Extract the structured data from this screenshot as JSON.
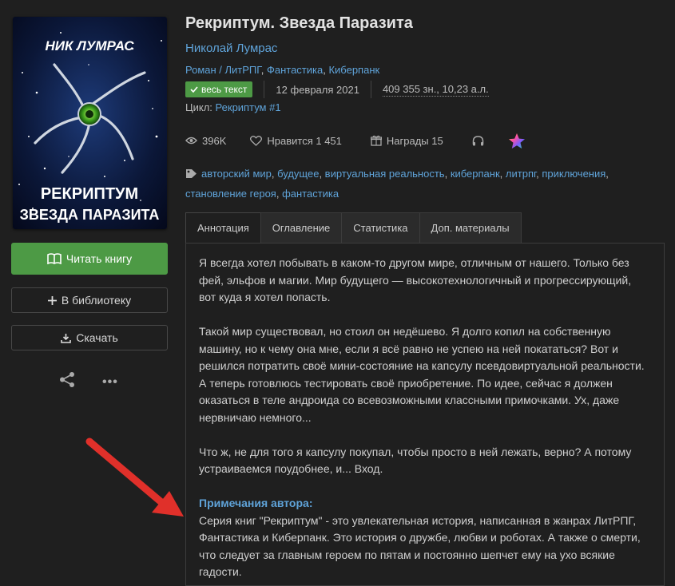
{
  "book": {
    "title": "Рекриптум. Звезда Паразита",
    "author": "Николай Лумрас",
    "genres": [
      "Роман / ЛитРПГ",
      "Фантастика",
      "Киберпанк"
    ],
    "status_badge": "весь текст",
    "date": "12 февраля 2021",
    "chars": "409 355 зн., 10,23 а.л.",
    "cycle_label": "Цикл:",
    "cycle": "Рекриптум #1"
  },
  "cover": {
    "author_text": "НИК ЛУМРАС",
    "title_line1": "РЕКРИПТУМ",
    "title_line2": "ЗВЕЗДА ПАРАЗИТА"
  },
  "buttons": {
    "read": "Читать книгу",
    "library": "В библиотеку",
    "download": "Скачать"
  },
  "stats": {
    "views": "396K",
    "likes": "Нравится 1 451",
    "awards": "Награды 15"
  },
  "tags": [
    "авторский мир",
    "будущее",
    "виртуальная реальность",
    "киберпанк",
    "литрпг",
    "приключения",
    "становление героя",
    "фантастика"
  ],
  "tabs": [
    "Аннотация",
    "Оглавление",
    "Статистика",
    "Доп. материалы"
  ],
  "annotation": {
    "p1": "Я всегда хотел побывать в каком-то другом мире, отличным от нашего. Только без фей, эльфов и магии. Мир будущего — высокотехнологичный и прогрессирующий, вот куда я хотел попасть.",
    "p2": "Такой мир существовал, но стоил он недёшево. Я долго копил на собственную машину, но к чему она мне, если я всё равно не успею на ней покататься? Вот и решился потратить своё мини-состояние на капсулу псевдовиртуальной реальности. А теперь готовлюсь тестировать своё приобретение. По идее, сейчас я должен оказаться в теле андроида со всевозможными классными примочками. Ух, даже нервничаю немного...",
    "p3": "Что ж, не для того я капсулу покупал, чтобы просто в ней лежать, верно? А потому устраиваемся поудобнее, и... Вход.",
    "notes_title": "Примечания автора:",
    "notes": "Серия книг \"Рекриптум\" - это увлекательная история, написанная в жанрах ЛитРПГ, Фантастика и Киберпанк. Это история о дружбе, любви и роботах. А также о смерти, что следует за главным героем по пятам и постоянно шепчет ему на ухо всякие гадости."
  },
  "colors": {
    "background": "#1f1f1f",
    "accent_green": "#4d9a45",
    "link_blue": "#5fa3d9",
    "arrow_red": "#e0302a"
  }
}
